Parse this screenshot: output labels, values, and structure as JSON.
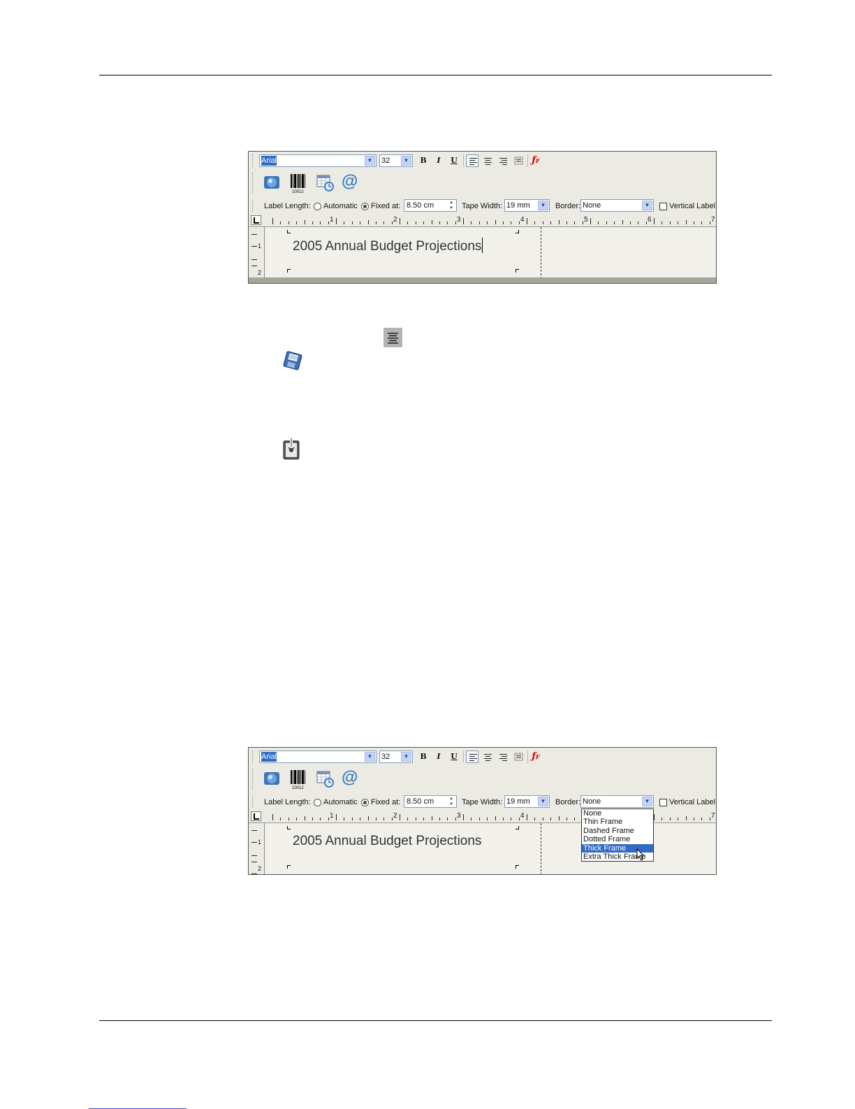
{
  "screens": [
    {
      "toolbar": {
        "font_value": "Arial",
        "size_value": "32",
        "bold": "B",
        "italic": "I",
        "underline": "U"
      },
      "label_bar": {
        "label_length": "Label Length:",
        "automatic": "Automatic",
        "fixed_at": "Fixed at:",
        "fixed_value": "8.50 cm",
        "tape_width": "Tape Width:",
        "tape_value": "19 mm",
        "border": "Border:",
        "border_value": "None",
        "vertical_label": "Vertical Label"
      },
      "ruler": {
        "h_numbers": [
          "1",
          "2",
          "3",
          "4",
          "5",
          "6",
          "7"
        ],
        "v_numbers": [
          "1",
          "2"
        ]
      },
      "label_text": "2005 Annual Budget Projections"
    },
    {
      "toolbar": {
        "font_value": "Arial",
        "size_value": "32",
        "bold": "B",
        "italic": "I",
        "underline": "U"
      },
      "label_bar": {
        "label_length": "Label Length:",
        "automatic": "Automatic",
        "fixed_at": "Fixed at:",
        "fixed_value": "8.50 cm",
        "tape_width": "Tape Width:",
        "tape_value": "19 mm",
        "border": "Border:",
        "border_value": "None",
        "vertical_label": "Vertical Label"
      },
      "ruler": {
        "h_numbers": [
          "1",
          "2",
          "3",
          "4",
          "5",
          "6",
          "7"
        ],
        "v_numbers": [
          "1",
          "2"
        ]
      },
      "label_text": "2005 Annual Budget Projections",
      "border_dropdown": {
        "options": [
          "None",
          "Thin Frame",
          "Dashed Frame",
          "Dotted Frame",
          "Thick Frame",
          "Extra Thick Frame"
        ],
        "highlighted": "Thick Frame"
      }
    }
  ],
  "inline_icons": [
    "center-align-icon",
    "save-disk-icon",
    "print-tape-icon"
  ],
  "colors": {
    "selection": "#316ac5",
    "toolbar_bg": "#ecebe3"
  }
}
